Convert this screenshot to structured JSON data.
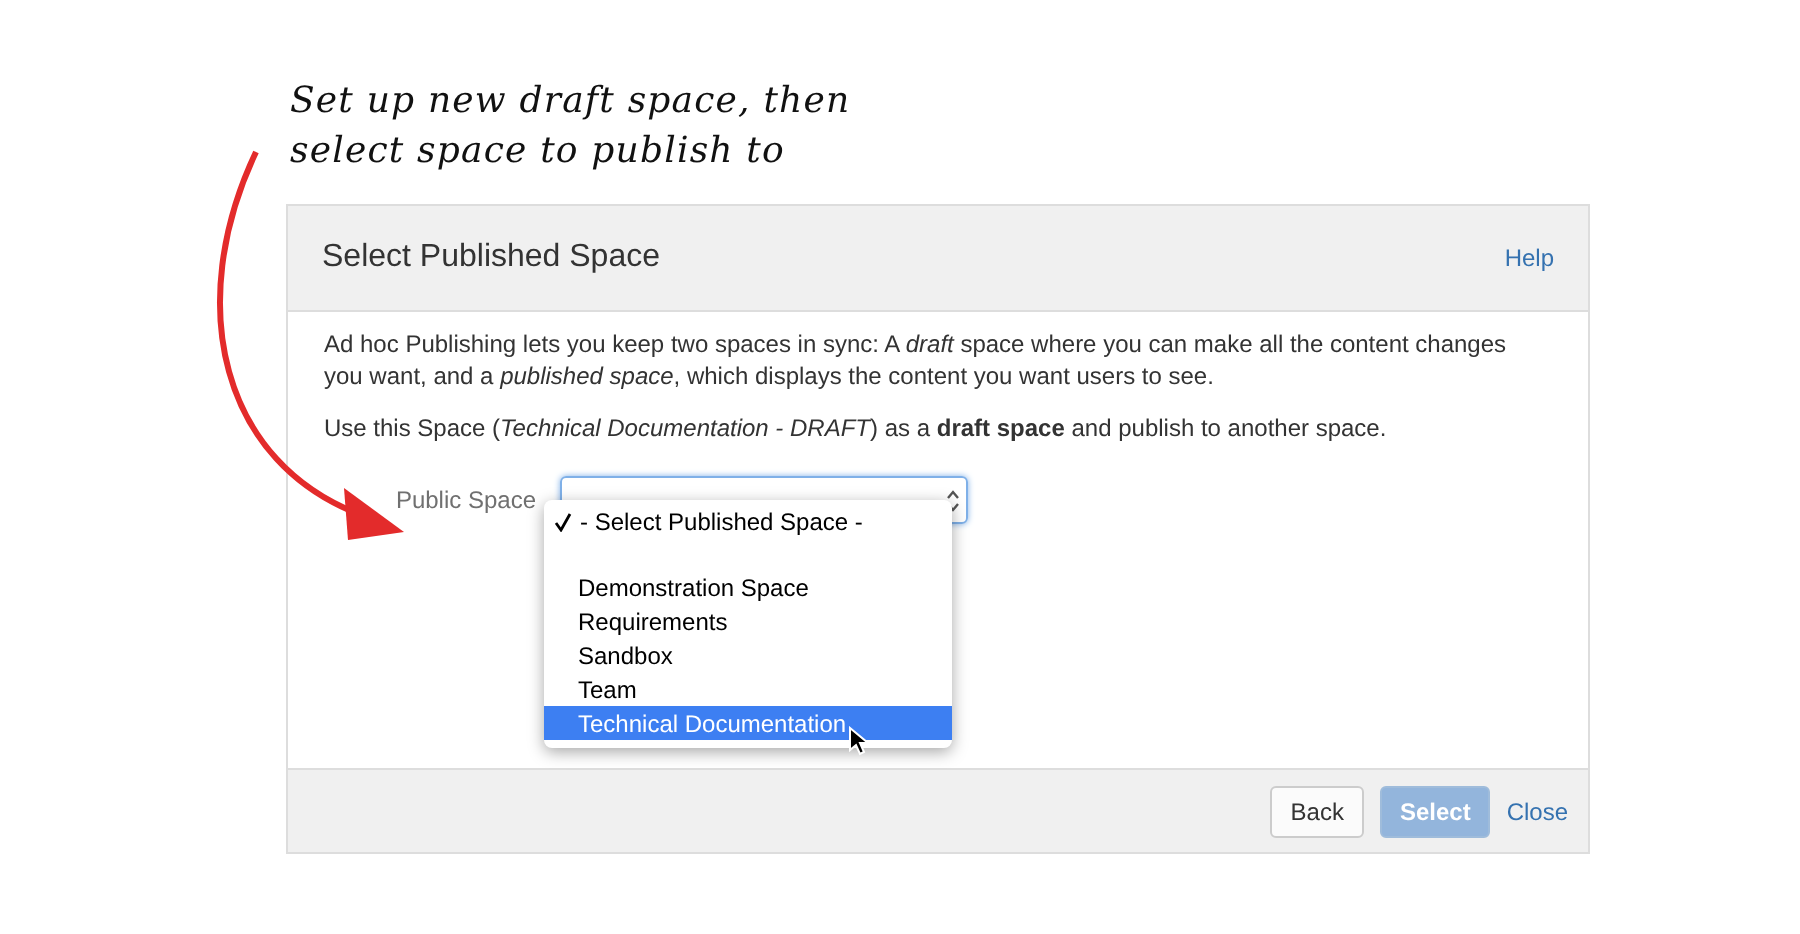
{
  "annotation": {
    "lines": [
      "Set up new draft space, then",
      "select space to publish to"
    ]
  },
  "dialog": {
    "title": "Select Published Space",
    "help_link": "Help",
    "paragraphs": [
      "Ad hoc Publishing lets you keep two spaces in sync: A *draft* space where you can make all the content changes you want, and a *published space*, which displays the content you want users to see.",
      "Use this Space (*Technical Documentation - DRAFT*) as a **draft space** and publish to another space."
    ],
    "field": {
      "label": "Public Space",
      "menu_open": true,
      "options": [
        {
          "label": "- Select Published Space -",
          "selected": true,
          "highlighted": false
        },
        {
          "label": "Demonstration Space",
          "selected": false,
          "highlighted": false
        },
        {
          "label": "Requirements",
          "selected": false,
          "highlighted": false
        },
        {
          "label": "Sandbox",
          "selected": false,
          "highlighted": false
        },
        {
          "label": "Team",
          "selected": false,
          "highlighted": false
        },
        {
          "label": "Technical Documentation",
          "selected": false,
          "highlighted": true
        }
      ]
    },
    "buttons": [
      {
        "label": "Back",
        "kind": "default",
        "disabled": false
      },
      {
        "label": "Select",
        "kind": "primary",
        "disabled": true
      },
      {
        "label": "Close",
        "kind": "link",
        "disabled": false
      }
    ]
  }
}
